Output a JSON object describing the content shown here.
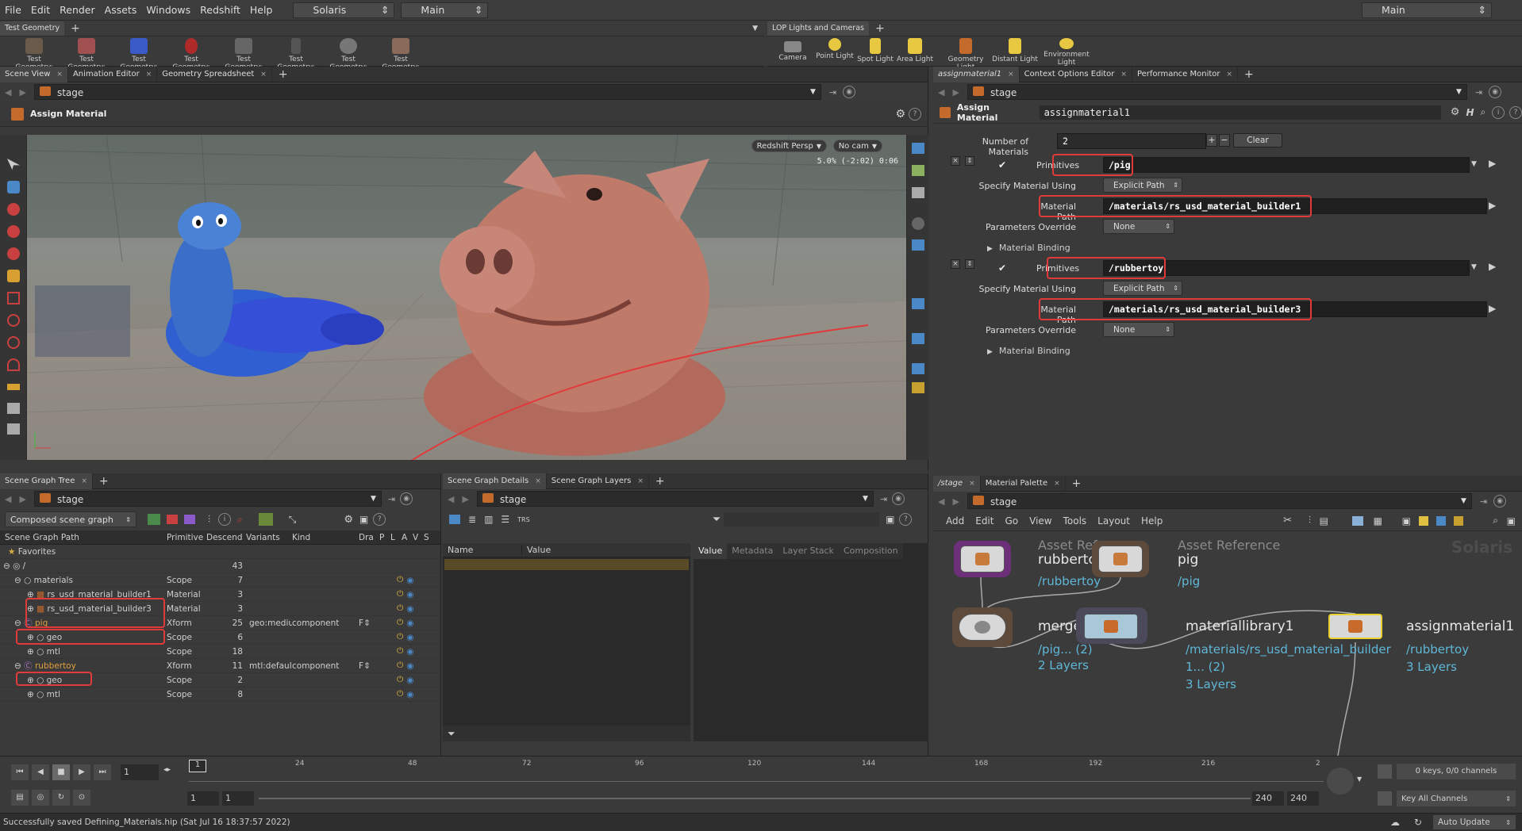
{
  "menubar": {
    "items": [
      "File",
      "Edit",
      "Render",
      "Assets",
      "Windows",
      "Redshift",
      "Help"
    ],
    "desktop": "Solaris",
    "context": "Main",
    "right_desktop": "Main"
  },
  "shelves": {
    "left_tab": "Test Geometry",
    "left_tools": [
      "Test Geometry: C...",
      "Test Geometry: P...",
      "Test Geometry: R...",
      "Test Geometry: S...",
      "Test Geometry: S...",
      "Test Geometry: T...",
      "Test Geometry: T...",
      "Test Geometry: T..."
    ],
    "right_tab": "LOP Lights and Cameras",
    "right_tools": [
      "Camera",
      "Point Light",
      "Spot Light",
      "Area Light",
      "Geometry Light",
      "Distant Light",
      "Environment Light"
    ]
  },
  "viewer": {
    "tabs": [
      "Scene View",
      "Animation Editor",
      "Geometry Spreadsheet"
    ],
    "path": "stage",
    "tool_title": "Assign Material",
    "camera_menu": "Redshift Persp",
    "cam_label": "No cam",
    "hud_text": "5.0%  (-2:02)  0:06"
  },
  "parm_pane": {
    "tabs": [
      "assignmaterial1",
      "Context Options Editor",
      "Performance Monitor"
    ],
    "path": "stage",
    "node_type": "Assign Material",
    "node_name": "assignmaterial1",
    "num_materials_label": "Number of Materials",
    "num_materials": "2",
    "clear_label": "Clear",
    "entries": [
      {
        "primitives_label": "Primitives",
        "primitives": "/pig",
        "specify_label": "Specify Material Using",
        "specify": "Explicit Path",
        "path_label": "Material Path",
        "path": "/materials/rs_usd_material_builder1",
        "override_label": "Parameters Override",
        "override": "None",
        "binding_label": "Material Binding"
      },
      {
        "primitives_label": "Primitives",
        "primitives": "/rubbertoy",
        "specify_label": "Specify Material Using",
        "specify": "Explicit Path",
        "path_label": "Material Path",
        "path": "/materials/rs_usd_material_builder3",
        "override_label": "Parameters Override",
        "override": "None",
        "binding_label": "Material Binding"
      }
    ]
  },
  "scene_graph": {
    "tab": "Scene Graph Tree",
    "path": "stage",
    "mode": "Composed scene graph",
    "columns": [
      "Scene Graph Path",
      "Primitive",
      "Descend",
      "Variants",
      "Kind",
      "Dra",
      "P",
      "L",
      "A",
      "V",
      "S"
    ],
    "rows": [
      {
        "name": "Favorites",
        "prim": "",
        "desc": "",
        "var": "",
        "kind": ""
      },
      {
        "name": "/",
        "prim": "",
        "desc": "43",
        "var": "",
        "kind": ""
      },
      {
        "name": "materials",
        "prim": "Scope",
        "desc": "7",
        "var": "",
        "kind": ""
      },
      {
        "name": "rs_usd_material_builder1",
        "prim": "Material",
        "desc": "3",
        "var": "",
        "kind": ""
      },
      {
        "name": "rs_usd_material_builder3",
        "prim": "Material",
        "desc": "3",
        "var": "",
        "kind": ""
      },
      {
        "name": "pig",
        "prim": "Xform",
        "desc": "25",
        "var": "geo:mediu",
        "kind": "component"
      },
      {
        "name": "geo",
        "prim": "Scope",
        "desc": "6",
        "var": "",
        "kind": ""
      },
      {
        "name": "mtl",
        "prim": "Scope",
        "desc": "18",
        "var": "",
        "kind": ""
      },
      {
        "name": "rubbertoy",
        "prim": "Xform",
        "desc": "11",
        "var": "mtl:default",
        "kind": "component"
      },
      {
        "name": "geo",
        "prim": "Scope",
        "desc": "2",
        "var": "",
        "kind": ""
      },
      {
        "name": "mtl",
        "prim": "Scope",
        "desc": "8",
        "var": "",
        "kind": ""
      }
    ]
  },
  "details": {
    "tabs": [
      "Scene Graph Details",
      "Scene Graph Layers"
    ],
    "path": "stage",
    "cols": [
      "Name",
      "Value"
    ],
    "subtabs": [
      "Value",
      "Metadata",
      "Layer Stack",
      "Composition"
    ]
  },
  "network": {
    "tabs": [
      "/stage",
      "Material Palette"
    ],
    "path": "stage",
    "menu": [
      "Add",
      "Edit",
      "Go",
      "View",
      "Tools",
      "Layout",
      "Help"
    ],
    "watermark": "Solaris",
    "nodes": [
      {
        "op": "Asset Reference",
        "name": "rubbertoy",
        "sub": "/rubbertoy"
      },
      {
        "op": "Asset Reference",
        "name": "pig",
        "sub": "/pig"
      },
      {
        "op": "",
        "name": "merge1",
        "sub": "/pig... (2)",
        "sub2": "2 Layers"
      },
      {
        "op": "",
        "name": "materiallibrary1",
        "sub": "/materials/rs_usd_material_builder",
        "sub2": "1... (2)",
        "sub3": "3 Layers"
      },
      {
        "op": "",
        "name": "assignmaterial1",
        "sub": "/rubbertoy",
        "sub2": "3 Layers"
      }
    ]
  },
  "timeline": {
    "frame": "1",
    "ticks": [
      "24",
      "48",
      "72",
      "96",
      "120",
      "144",
      "168",
      "192",
      "216",
      "2"
    ],
    "current_marker": "1",
    "range_start": "1",
    "range_start2": "1",
    "range_end": "240",
    "range_end2": "240",
    "keys": "0 keys, 0/0 channels",
    "key_mode": "Key All Channels"
  },
  "status": {
    "message": "Successfully saved Defining_Materials.hip (Sat Jul 16 18:37:57 2022)",
    "update": "Auto Update"
  }
}
